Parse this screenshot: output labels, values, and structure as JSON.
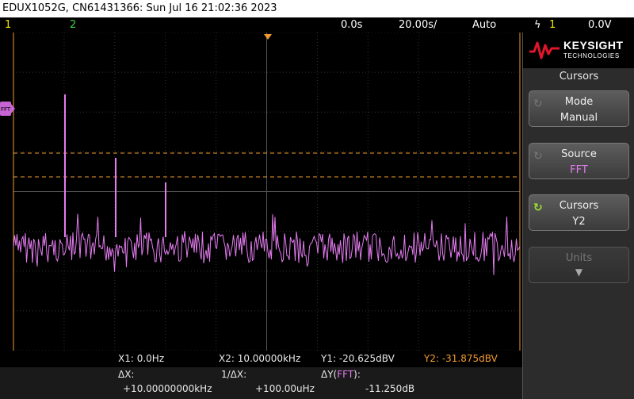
{
  "title_bar": "EDUX1052G, CN61431366: Sun Jul 16 21:02:36 2023",
  "status": {
    "ch1_label": "1",
    "ch2_label": "2",
    "delay": "0.0s",
    "timebase": "20.00s/",
    "trigger_mode": "Auto",
    "trigger_icon": "ϟ",
    "trigger_source": "1",
    "trigger_level": "0.0V"
  },
  "waveform": {
    "marker_label": "FFT",
    "trace_color": "#e47cf0",
    "cursor_color": "#f29a2e",
    "grid_color": "#3a3a3a"
  },
  "brand": {
    "name": "KEYSIGHT",
    "sub": "TECHNOLOGIES"
  },
  "menu": {
    "title": "Cursors",
    "softkeys": [
      {
        "line1": "Mode",
        "line2": "Manual",
        "icon": "rotate-icon"
      },
      {
        "line1": "Source",
        "line2": "FFT",
        "icon": "rotate-icon"
      },
      {
        "line1": "Cursors",
        "line2": "Y2",
        "icon": "rotate-icon"
      },
      {
        "line1": "Units",
        "line2": "",
        "icon": "down-arrow-icon"
      }
    ]
  },
  "readout": {
    "x1": "X1:  0.0Hz",
    "x2": "X2:  10.00000kHz",
    "y1": "Y1: -20.625dBV",
    "y2": "Y2: -31.875dBV",
    "dx_label": "ΔX:",
    "dx_value": "+10.00000000kHz",
    "inv_dx_label": "1/ΔX:",
    "inv_dx_value": "+100.00uHz",
    "dy_label": "ΔY(",
    "dy_src": "FFT",
    "dy_close": "):",
    "dy_value": "-11.250dB"
  }
}
